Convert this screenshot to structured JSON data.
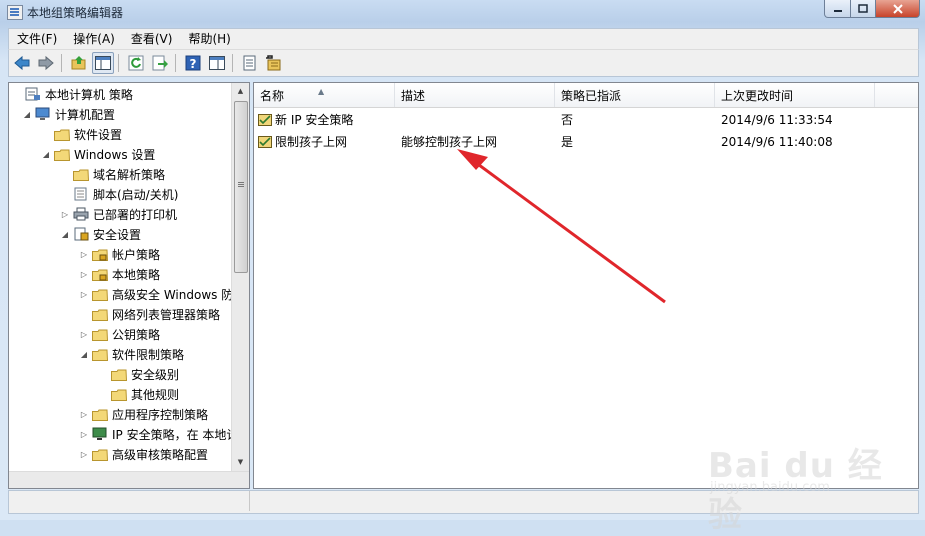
{
  "window": {
    "title": "本地组策略编辑器"
  },
  "menubar": [
    {
      "label": "文件(F)"
    },
    {
      "label": "操作(A)"
    },
    {
      "label": "查看(V)"
    },
    {
      "label": "帮助(H)"
    }
  ],
  "toolbar": {
    "icons": [
      "back-icon",
      "forward-icon",
      "up-folder-icon",
      "show-tree-icon",
      "refresh-icon",
      "export-icon",
      "help-icon",
      "console-tree-icon",
      "properties-icon",
      "add-policy-icon"
    ]
  },
  "tree": {
    "items": [
      {
        "label": "本地计算机 策略",
        "level": 0,
        "arrow": "",
        "icon": "computer-policy-icon"
      },
      {
        "label": "计算机配置",
        "level": 1,
        "arrow": "◢",
        "icon": "computer-icon"
      },
      {
        "label": "软件设置",
        "level": 2,
        "arrow": "",
        "icon": "folder-icon"
      },
      {
        "label": "Windows 设置",
        "level": 2,
        "arrow": "◢",
        "icon": "folder-icon"
      },
      {
        "label": "域名解析策略",
        "level": 3,
        "arrow": "",
        "icon": "folder-icon"
      },
      {
        "label": "脚本(启动/关机)",
        "level": 3,
        "arrow": "",
        "icon": "script-icon"
      },
      {
        "label": "已部署的打印机",
        "level": 3,
        "arrow": "▷",
        "icon": "printer-icon"
      },
      {
        "label": "安全设置",
        "level": 3,
        "arrow": "◢",
        "icon": "security-icon"
      },
      {
        "label": "帐户策略",
        "level": 4,
        "arrow": "▷",
        "icon": "folder-lock-icon"
      },
      {
        "label": "本地策略",
        "level": 4,
        "arrow": "▷",
        "icon": "folder-lock-icon"
      },
      {
        "label": "高级安全 Windows 防",
        "level": 4,
        "arrow": "▷",
        "icon": "folder-icon"
      },
      {
        "label": "网络列表管理器策略",
        "level": 4,
        "arrow": "",
        "icon": "folder-icon"
      },
      {
        "label": "公钥策略",
        "level": 4,
        "arrow": "▷",
        "icon": "folder-icon"
      },
      {
        "label": "软件限制策略",
        "level": 4,
        "arrow": "◢",
        "icon": "folder-icon"
      },
      {
        "label": "安全级别",
        "level": 5,
        "arrow": "",
        "icon": "folder-icon"
      },
      {
        "label": "其他规则",
        "level": 5,
        "arrow": "",
        "icon": "folder-icon"
      },
      {
        "label": "应用程序控制策略",
        "level": 4,
        "arrow": "▷",
        "icon": "folder-icon"
      },
      {
        "label": "IP 安全策略，在 本地计",
        "level": 4,
        "arrow": "▷",
        "icon": "ip-security-icon"
      },
      {
        "label": "高级审核策略配置",
        "level": 4,
        "arrow": "▷",
        "icon": "folder-icon"
      }
    ]
  },
  "list": {
    "columns": [
      "名称",
      "描述",
      "策略已指派",
      "上次更改时间"
    ],
    "rows": [
      {
        "name": "新 IP 安全策略",
        "description": "",
        "assigned": "否",
        "modified": "2014/9/6 11:33:54"
      },
      {
        "name": "限制孩子上网",
        "description": "能够控制孩子上网",
        "assigned": "是",
        "modified": "2014/9/6 11:40:08"
      }
    ]
  },
  "watermark": {
    "text": "Bai du 经验",
    "sub": "jingyan.baidu.com"
  },
  "colors": {
    "accent": "#3c7fb1",
    "annotation_arrow": "#e0262b"
  }
}
